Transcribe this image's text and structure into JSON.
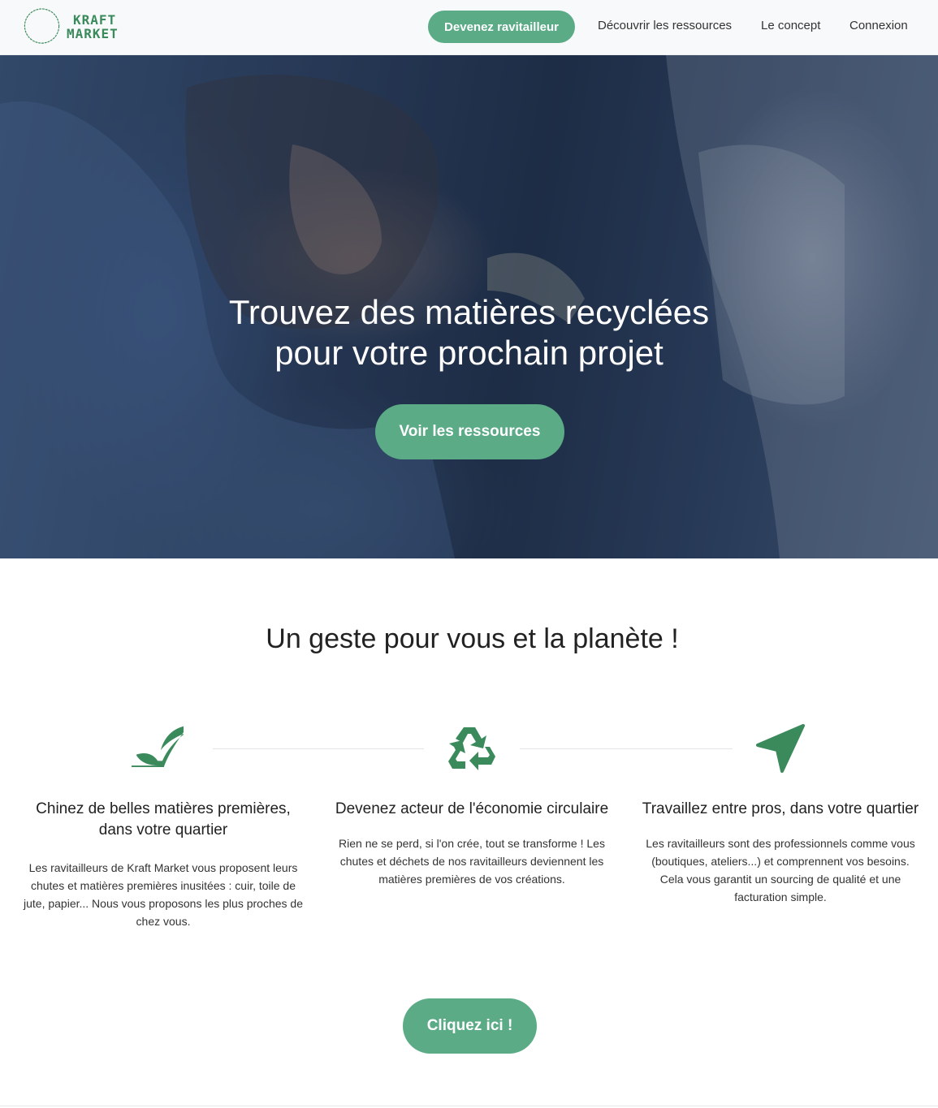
{
  "brand": {
    "line1": "KRAFT",
    "line2": "MARKET"
  },
  "nav": {
    "cta": "Devenez ravitailleur",
    "links": [
      "Découvrir les ressources",
      "Le concept",
      "Connexion"
    ]
  },
  "hero": {
    "title_line1": "Trouvez des matières recyclées",
    "title_line2": "pour votre prochain projet",
    "button": "Voir les ressources"
  },
  "section": {
    "title": "Un geste pour vous et la planète !",
    "features": [
      {
        "icon": "leaf-icon",
        "title_line1": "Chinez de belles matières premières,",
        "title_line2": "dans votre quartier",
        "text": "Les ravitailleurs de Kraft Market vous proposent leurs chutes et matières premières inusitées : cuir, toile de jute, papier... Nous vous proposons les plus proches de chez vous."
      },
      {
        "icon": "recycle-icon",
        "title_line1": "Devenez acteur de l'économie circulaire",
        "title_line2": "",
        "text": "Rien ne se perd, si l'on crée, tout se transforme ! Les chutes et déchets de nos ravitailleurs deviennent les matières premières de vos créations."
      },
      {
        "icon": "location-arrow-icon",
        "title_line1": "Travaillez entre pros, dans votre quartier",
        "title_line2": "",
        "text": "Les ravitailleurs sont des professionnels comme vous (boutiques, ateliers...) et comprennent vos besoins. Cela vous garantit un sourcing de qualité et une facturation simple."
      }
    ],
    "cta": "Cliquez ici !"
  },
  "colors": {
    "accent": "#5aab86",
    "icon": "#3a8a5c",
    "text": "#222222"
  }
}
